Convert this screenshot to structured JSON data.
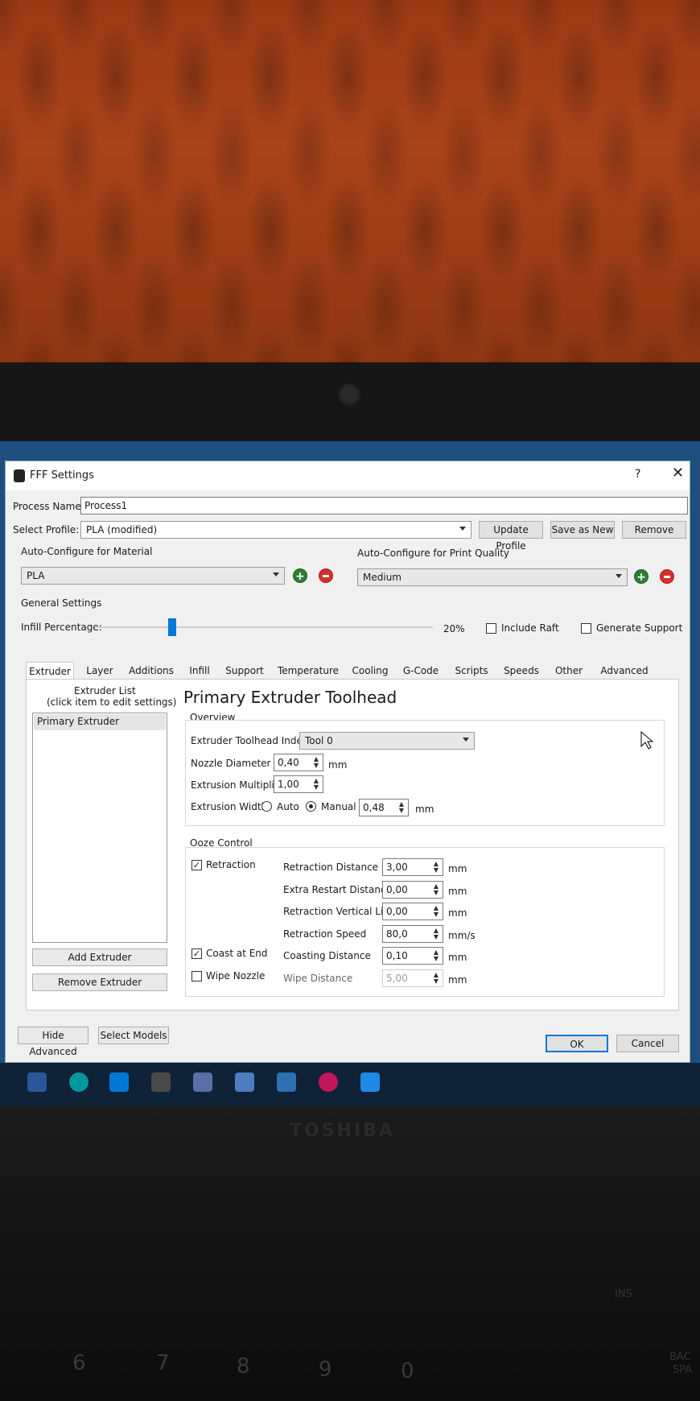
{
  "window": {
    "title": "FFF Settings",
    "help": "?",
    "close": "✕"
  },
  "process": {
    "label": "Process Name:",
    "value": "Process1"
  },
  "profile": {
    "label": "Select Profile:",
    "value": "PLA (modified)",
    "update": "Update Profile",
    "save_new": "Save as New",
    "remove": "Remove"
  },
  "material": {
    "label": "Auto-Configure for Material",
    "value": "PLA"
  },
  "quality": {
    "label": "Auto-Configure for Print Quality",
    "value": "Medium"
  },
  "general": {
    "label": "General Settings",
    "infill_label": "Infill Percentage:",
    "infill_value": "20%",
    "infill_fraction": 0.2,
    "raft": "Include Raft",
    "support": "Generate Support"
  },
  "tabs": [
    "Extruder",
    "Layer",
    "Additions",
    "Infill",
    "Support",
    "Temperature",
    "Cooling",
    "G-Code",
    "Scripts",
    "Speeds",
    "Other",
    "Advanced"
  ],
  "extruder_list": {
    "title": "Extruder List",
    "hint": "(click item to edit settings)",
    "items": [
      "Primary Extruder"
    ],
    "add": "Add Extruder",
    "remove": "Remove Extruder"
  },
  "toolhead": {
    "heading": "Primary Extruder Toolhead",
    "overview": "Overview",
    "index_label": "Extruder Toolhead Index",
    "index_value": "Tool 0",
    "nozzle_label": "Nozzle Diameter",
    "nozzle_value": "0,40",
    "nozzle_unit": "mm",
    "mult_label": "Extrusion Multiplier",
    "mult_value": "1,00",
    "width_label": "Extrusion Width",
    "auto": "Auto",
    "manual": "Manual",
    "width_value": "0,48",
    "width_unit": "mm"
  },
  "ooze": {
    "title": "Ooze Control",
    "retraction": "Retraction",
    "coast": "Coast at End",
    "wipe": "Wipe Nozzle",
    "rows": [
      {
        "label": "Retraction Distance",
        "value": "3,00",
        "unit": "mm"
      },
      {
        "label": "Extra Restart Distance",
        "value": "0,00",
        "unit": "mm"
      },
      {
        "label": "Retraction Vertical Lift",
        "value": "0,00",
        "unit": "mm"
      },
      {
        "label": "Retraction Speed",
        "value": "80,0",
        "unit": "mm/s"
      },
      {
        "label": "Coasting Distance",
        "value": "0,10",
        "unit": "mm"
      },
      {
        "label": "Wipe Distance",
        "value": "5,00",
        "unit": "mm"
      }
    ]
  },
  "footer": {
    "hide_advanced": "Hide Advanced",
    "select_models": "Select Models",
    "ok": "OK",
    "cancel": "Cancel"
  },
  "laptop": {
    "brand": "TOSHIBA",
    "keys": [
      "6",
      "7",
      "8",
      "9",
      "0"
    ],
    "fn": [
      "INS",
      "BAC",
      "SPA"
    ]
  }
}
